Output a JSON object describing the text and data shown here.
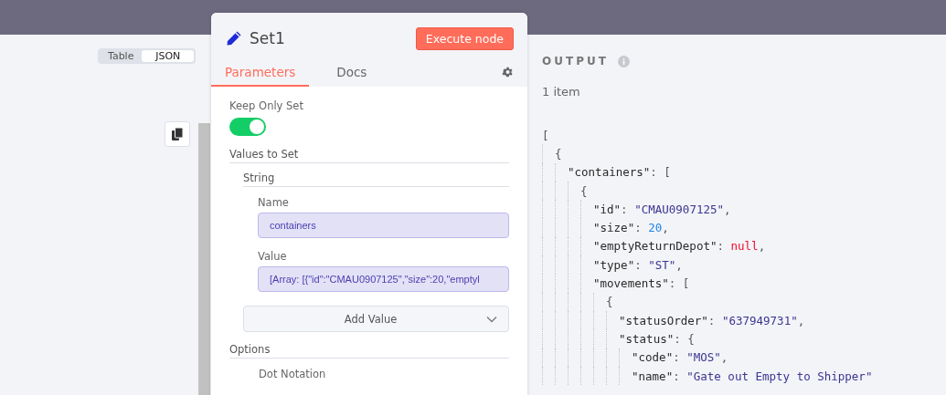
{
  "view_switch": [
    {
      "label": "Table",
      "selected": false
    },
    {
      "label": "JSON",
      "selected": true
    }
  ],
  "node_panel": {
    "title": "Set1",
    "execute_button": "Execute node",
    "tabs": [
      {
        "label": "Parameters",
        "selected": true
      },
      {
        "label": "Docs",
        "selected": false
      }
    ],
    "keep_only_set": {
      "label": "Keep Only Set",
      "on": true
    },
    "values_heading": "Values to Set",
    "string_heading": "String",
    "fields": [
      {
        "label": "Name",
        "value": "containers"
      },
      {
        "label": "Value",
        "value": "[Array: [{\"id\":\"CMAU0907125\",\"size\":20,\"emptyl"
      }
    ],
    "add_value": "Add Value",
    "options_heading": "Options",
    "option_label": "Dot Notation"
  },
  "output": {
    "title": "OUTPUT",
    "count": "1 item",
    "lines": [
      {
        "tokens": [
          {
            "kind": "punct",
            "text": "["
          }
        ],
        "children": [
          {
            "tokens": [
              {
                "kind": "punct",
                "text": "{"
              }
            ],
            "children": [
              {
                "tokens": [
                  {
                    "kind": "key",
                    "text": "\"containers\""
                  },
                  {
                    "kind": "punct",
                    "text": ": ["
                  }
                ],
                "children": [
                  {
                    "tokens": [
                      {
                        "kind": "punct",
                        "text": "{"
                      }
                    ],
                    "children": [
                      {
                        "tokens": [
                          {
                            "kind": "key",
                            "text": "\"id\""
                          },
                          {
                            "kind": "punct",
                            "text": ": "
                          },
                          {
                            "kind": "string",
                            "text": "\"CMAU0907125\""
                          },
                          {
                            "kind": "punct",
                            "text": ","
                          }
                        ]
                      },
                      {
                        "tokens": [
                          {
                            "kind": "key",
                            "text": "\"size\""
                          },
                          {
                            "kind": "punct",
                            "text": ": "
                          },
                          {
                            "kind": "number",
                            "text": "20"
                          },
                          {
                            "kind": "punct",
                            "text": ","
                          }
                        ]
                      },
                      {
                        "tokens": [
                          {
                            "kind": "key",
                            "text": "\"emptyReturnDepot\""
                          },
                          {
                            "kind": "punct",
                            "text": ": "
                          },
                          {
                            "kind": "null",
                            "text": "null"
                          },
                          {
                            "kind": "punct",
                            "text": ","
                          }
                        ]
                      },
                      {
                        "tokens": [
                          {
                            "kind": "key",
                            "text": "\"type\""
                          },
                          {
                            "kind": "punct",
                            "text": ": "
                          },
                          {
                            "kind": "string",
                            "text": "\"ST\""
                          },
                          {
                            "kind": "punct",
                            "text": ","
                          }
                        ]
                      },
                      {
                        "tokens": [
                          {
                            "kind": "key",
                            "text": "\"movements\""
                          },
                          {
                            "kind": "punct",
                            "text": ": ["
                          }
                        ],
                        "children": [
                          {
                            "tokens": [
                              {
                                "kind": "punct",
                                "text": "{"
                              }
                            ],
                            "children": [
                              {
                                "tokens": [
                                  {
                                    "kind": "key",
                                    "text": "\"statusOrder\""
                                  },
                                  {
                                    "kind": "punct",
                                    "text": ": "
                                  },
                                  {
                                    "kind": "string",
                                    "text": "\"637949731\""
                                  },
                                  {
                                    "kind": "punct",
                                    "text": ","
                                  }
                                ]
                              },
                              {
                                "tokens": [
                                  {
                                    "kind": "key",
                                    "text": "\"status\""
                                  },
                                  {
                                    "kind": "punct",
                                    "text": ": {"
                                  }
                                ],
                                "children": [
                                  {
                                    "tokens": [
                                      {
                                        "kind": "key",
                                        "text": "\"code\""
                                      },
                                      {
                                        "kind": "punct",
                                        "text": ": "
                                      },
                                      {
                                        "kind": "string",
                                        "text": "\"MOS\""
                                      },
                                      {
                                        "kind": "punct",
                                        "text": ","
                                      }
                                    ]
                                  },
                                  {
                                    "tokens": [
                                      {
                                        "kind": "key",
                                        "text": "\"name\""
                                      },
                                      {
                                        "kind": "punct",
                                        "text": ": "
                                      },
                                      {
                                        "kind": "string",
                                        "text": "\"Gate out Empty to Shipper\""
                                      }
                                    ]
                                  }
                                ]
                              }
                            ]
                          }
                        ]
                      }
                    ]
                  }
                ]
              }
            ]
          }
        ]
      }
    ]
  }
}
